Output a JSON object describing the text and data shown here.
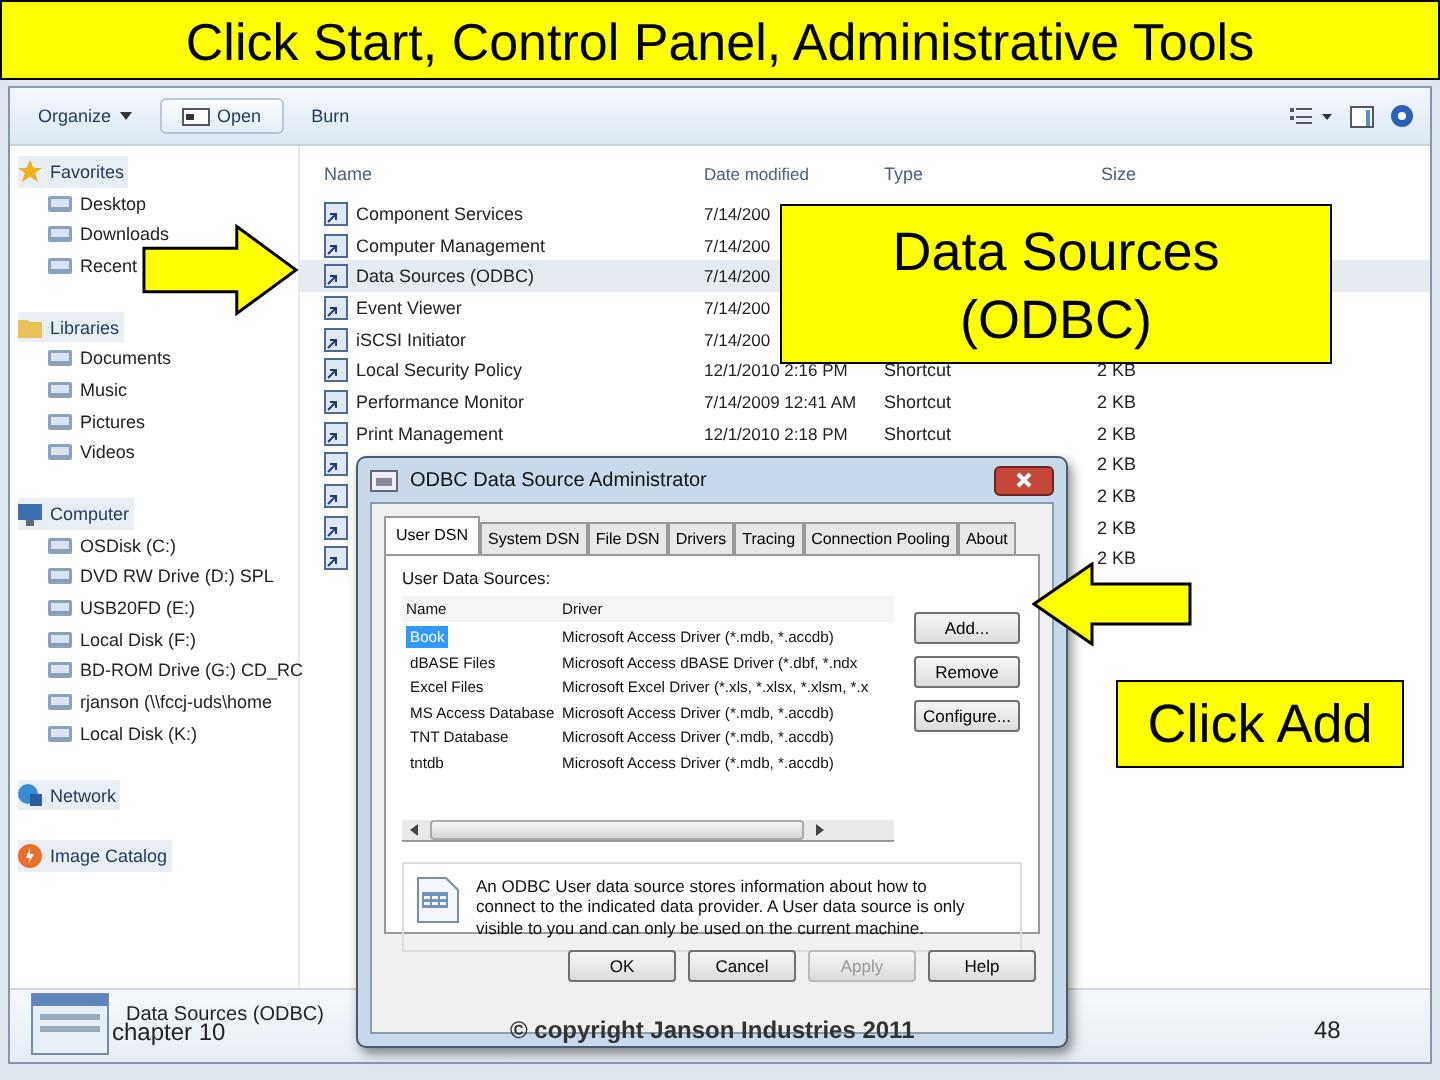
{
  "slide": {
    "title": "Click Start, Control Panel, Administrative Tools",
    "footer_left": "chapter 10",
    "footer_center": "© copyright Janson Industries 2011",
    "page_number": "48"
  },
  "explorer": {
    "toolbar": [
      {
        "label": "Organize",
        "kind": "menu"
      },
      {
        "label": "Open",
        "kind": "open"
      },
      {
        "label": "Burn",
        "kind": "plain"
      }
    ],
    "nav": [
      {
        "label": "Favorites",
        "kind": "star",
        "children": [
          {
            "label": "Desktop"
          },
          {
            "label": "Downloads"
          },
          {
            "label": "Recent"
          }
        ]
      },
      {
        "label": "Libraries",
        "kind": "folder",
        "children": [
          {
            "label": "Documents"
          },
          {
            "label": "Music"
          },
          {
            "label": "Pictures"
          },
          {
            "label": "Videos"
          }
        ]
      },
      {
        "label": "Computer",
        "kind": "computer",
        "children": [
          {
            "label": "OSDisk (C:)"
          },
          {
            "label": "DVD RW Drive (D:) SPL"
          },
          {
            "label": "USB20FD (E:)"
          },
          {
            "label": "Local Disk (F:)"
          },
          {
            "label": "BD-ROM Drive (G:) CD_RC"
          },
          {
            "label": "rjanson (\\\\fccj-uds\\home"
          },
          {
            "label": "Local Disk (K:)"
          }
        ]
      },
      {
        "label": "Network",
        "kind": "network"
      },
      {
        "label": "Image Catalog",
        "kind": "catalog"
      }
    ],
    "columns": [
      "Name",
      "Date modified",
      "Type",
      "Size"
    ],
    "rows": [
      {
        "name": "Component Services",
        "date": "7/14/200",
        "selected": false
      },
      {
        "name": "Computer Management",
        "date": "7/14/200",
        "selected": false
      },
      {
        "name": "Data Sources (ODBC)",
        "date": "7/14/200",
        "selected": true
      },
      {
        "name": "Event Viewer",
        "date": "7/14/200",
        "selected": false
      },
      {
        "name": "iSCSI Initiator",
        "date": "7/14/200",
        "selected": false
      },
      {
        "name": "Local Security Policy",
        "date": "12/1/2010 2:16 PM",
        "type": "Shortcut",
        "size": "2 KB",
        "selected": false
      },
      {
        "name": "Performance Monitor",
        "date": "7/14/2009 12:41 AM",
        "type": "Shortcut",
        "size": "2 KB",
        "selected": false
      },
      {
        "name": "Print Management",
        "date": "12/1/2010 2:18 PM",
        "type": "Shortcut",
        "size": "2 KB",
        "selected": false
      },
      {
        "size": "2 KB",
        "selected": false
      },
      {
        "size": "2 KB",
        "selected": false
      },
      {
        "size": "2 KB",
        "selected": false
      },
      {
        "size": "2 KB",
        "selected": false
      }
    ],
    "details": {
      "name": "Data Sources (ODBC)"
    }
  },
  "dialog": {
    "title": "ODBC Data Source Administrator",
    "tabs": [
      {
        "label": "User DSN",
        "selected": true
      },
      {
        "label": "System DSN",
        "selected": false
      },
      {
        "label": "File DSN",
        "selected": false
      },
      {
        "label": "Drivers",
        "selected": false
      },
      {
        "label": "Tracing",
        "selected": false
      },
      {
        "label": "Connection Pooling",
        "selected": false
      },
      {
        "label": "About",
        "selected": false
      }
    ],
    "list_label": "User Data Sources:",
    "columns": [
      "Name",
      "Driver"
    ],
    "sources": [
      {
        "name": "Book",
        "driver": "Microsoft Access Driver (*.mdb, *.accdb)",
        "selected": true
      },
      {
        "name": "dBASE Files",
        "driver": "Microsoft Access dBASE Driver (*.dbf, *.ndx",
        "selected": false
      },
      {
        "name": "Excel Files",
        "driver": "Microsoft Excel Driver (*.xls, *.xlsx, *.xlsm, *.x",
        "selected": false
      },
      {
        "name": "MS Access Database",
        "driver": "Microsoft Access Driver (*.mdb, *.accdb)",
        "selected": false
      },
      {
        "name": "TNT Database",
        "driver": "Microsoft Access Driver (*.mdb, *.accdb)",
        "selected": false
      },
      {
        "name": "tntdb",
        "driver": "Microsoft Access Driver (*.mdb, *.accdb)",
        "selected": false
      }
    ],
    "side_buttons": [
      "Add...",
      "Remove",
      "Configure..."
    ],
    "info": "An ODBC User data source stores information about how to connect to the indicated data provider.   A User data source is only visible to you and can only be used on the current machine.",
    "buttons": [
      {
        "label": "OK",
        "disabled": false
      },
      {
        "label": "Cancel",
        "disabled": false
      },
      {
        "label": "Apply",
        "disabled": true
      },
      {
        "label": "Help",
        "disabled": false
      }
    ]
  },
  "callouts": [
    {
      "text": "Data Sources (ODBC)"
    },
    {
      "text": "Click Add"
    }
  ]
}
